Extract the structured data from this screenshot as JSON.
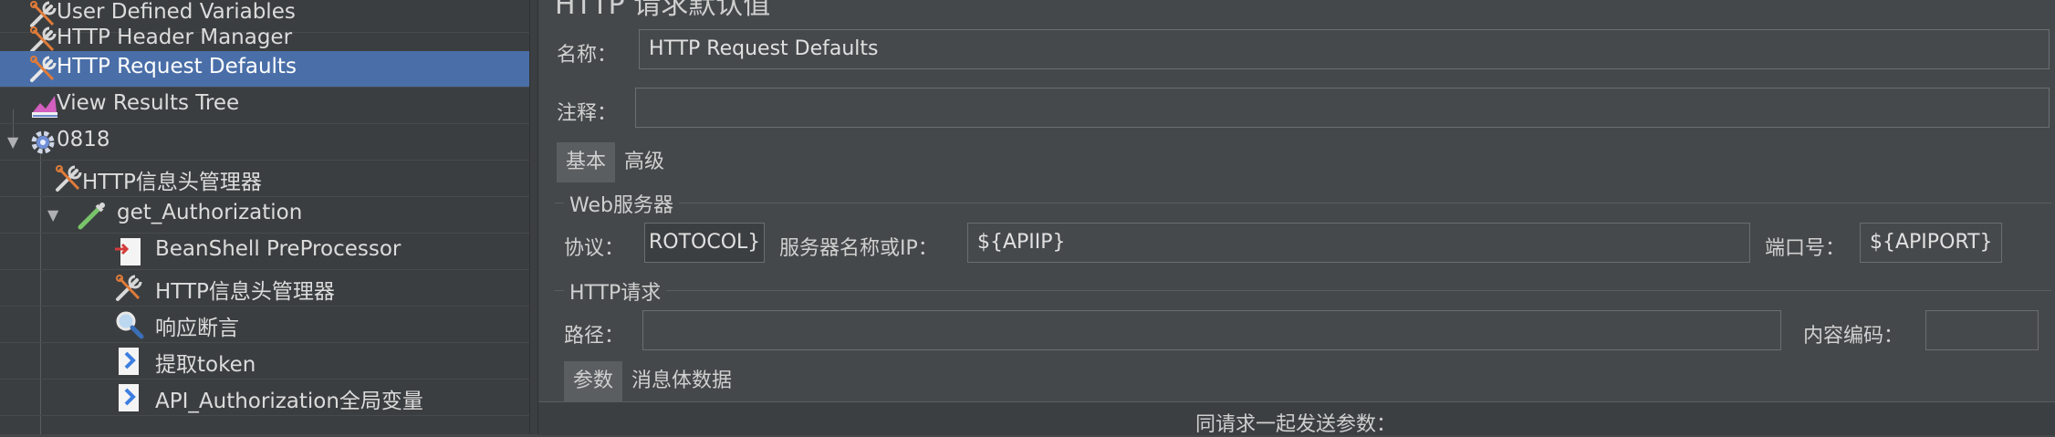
{
  "tree": {
    "items": [
      {
        "label": "User Defined Variables",
        "icon": "wrench-scissors-icon"
      },
      {
        "label": "HTTP Header Manager",
        "icon": "wrench-scissors-icon"
      },
      {
        "label": "HTTP Request Defaults",
        "icon": "wrench-scissors-icon",
        "selected": true
      },
      {
        "label": "View Results Tree",
        "icon": "chart-icon"
      },
      {
        "label": "0818",
        "icon": "gear-icon"
      },
      {
        "label": "HTTP信息头管理器",
        "icon": "wrench-scissors-icon"
      },
      {
        "label": "get_Authorization",
        "icon": "pipette-icon"
      },
      {
        "label": "BeanShell PreProcessor",
        "icon": "preprocessor-icon"
      },
      {
        "label": "HTTP信息头管理器",
        "icon": "wrench-scissors-icon"
      },
      {
        "label": "响应断言",
        "icon": "magnifier-icon"
      },
      {
        "label": "提取token",
        "icon": "extractor-icon"
      },
      {
        "label": "API_Authorization全局变量",
        "icon": "extractor-icon"
      }
    ]
  },
  "panel": {
    "title": "HTTP 请求默认值",
    "name_label": "名称：",
    "name_value": "HTTP Request Defaults",
    "comment_label": "注释：",
    "comment_value": "",
    "tabs": [
      {
        "label": "基本",
        "active": true
      },
      {
        "label": "高级",
        "active": false
      }
    ],
    "web_server": {
      "section_title": "Web服务器",
      "protocol_label": "协议：",
      "protocol_value": "ROTOCOL}",
      "server_label": "服务器名称或IP：",
      "server_value": "${APIIP}",
      "port_label": "端口号：",
      "port_value": "${APIPORT}"
    },
    "http_request": {
      "section_title": "HTTP请求",
      "path_label": "路径：",
      "path_value": "",
      "encoding_label": "内容编码：",
      "encoding_value": ""
    },
    "sub_tabs": [
      {
        "label": "参数",
        "active": true
      },
      {
        "label": "消息体数据",
        "active": false
      }
    ],
    "params_caption": "同请求一起发送参数："
  },
  "colors": {
    "selection": "#4a6fa8",
    "background": "#45484a",
    "tree_background": "#3b3e40"
  }
}
